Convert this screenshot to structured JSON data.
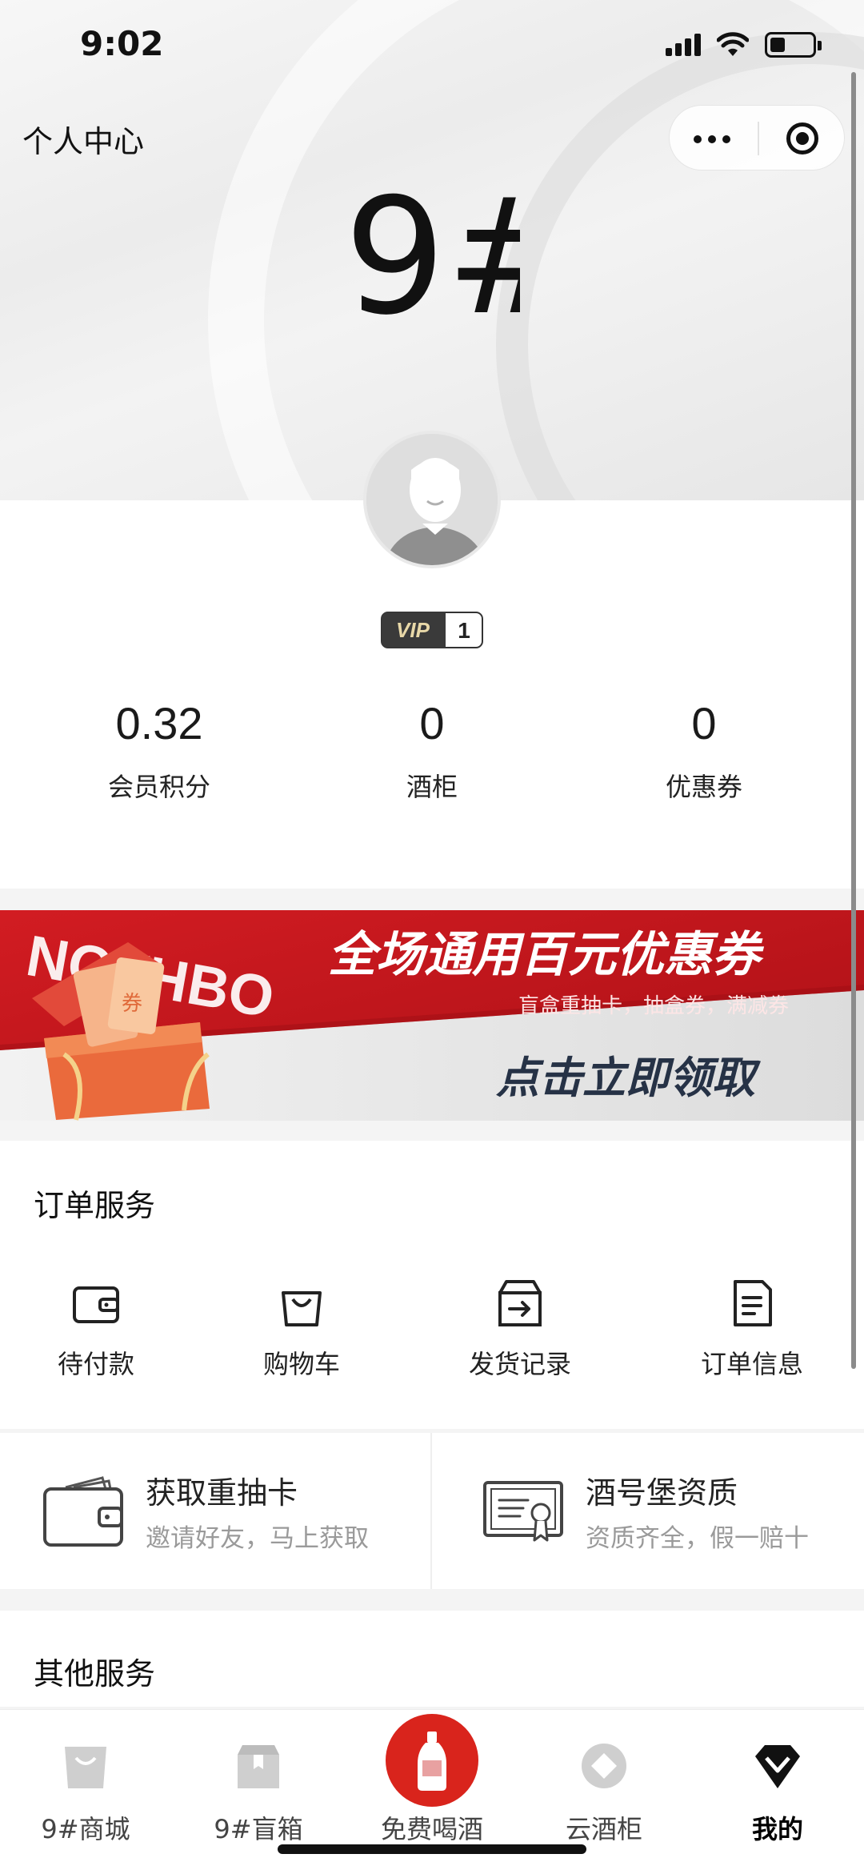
{
  "status_bar": {
    "time": "9:02"
  },
  "nav": {
    "title": "个人中心"
  },
  "brand": {
    "logo_text": "9#"
  },
  "profile": {
    "vip_label": "VIP",
    "vip_level": "1"
  },
  "stats": [
    {
      "value": "0.32",
      "label": "会员积分"
    },
    {
      "value": "0",
      "label": "酒柜"
    },
    {
      "value": "0",
      "label": "优惠券"
    }
  ],
  "banner": {
    "title": "全场通用百元优惠券",
    "subtitle": "盲盒重抽卡，抽盒券，满减券",
    "cta": "点击立即领取",
    "watermark": "NOTHBO",
    "coupon_char": "券"
  },
  "order_service": {
    "title": "订单服务",
    "items": [
      {
        "label": "待付款",
        "icon": "wallet-icon"
      },
      {
        "label": "购物车",
        "icon": "shopping-bag-icon"
      },
      {
        "label": "发货记录",
        "icon": "shipping-box-icon"
      },
      {
        "label": "订单信息",
        "icon": "document-icon"
      }
    ]
  },
  "promos": [
    {
      "title": "获取重抽卡",
      "subtitle": "邀请好友，马上获取",
      "icon": "wallet-card-icon"
    },
    {
      "title": "酒号堡资质",
      "subtitle": "资质齐全，假一赔十",
      "icon": "certificate-icon"
    }
  ],
  "other_service": {
    "title": "其他服务"
  },
  "tabbar": [
    {
      "label": "9#商城",
      "icon": "store-bag-icon",
      "active": false
    },
    {
      "label": "9#盲箱",
      "icon": "blind-box-icon",
      "active": false
    },
    {
      "label": "免费喝酒",
      "icon": "bottle-icon",
      "active": false
    },
    {
      "label": "云酒柜",
      "icon": "cloud-cabinet-icon",
      "active": false
    },
    {
      "label": "我的",
      "icon": "diamond-profile-icon",
      "active": true
    }
  ],
  "colors": {
    "accent_red": "#c3161c",
    "tab_center_red": "#d9241c",
    "text_dark": "#1a1a1a",
    "text_muted": "#9a9a9a"
  }
}
